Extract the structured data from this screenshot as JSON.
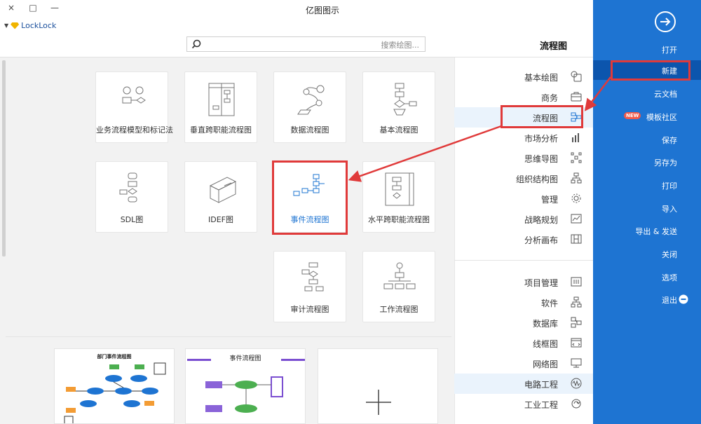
{
  "window": {
    "title": "亿图图示",
    "controls": [
      "×",
      "□",
      "—"
    ]
  },
  "user": {
    "name": "LockLock"
  },
  "search": {
    "placeholder": "搜索绘图..."
  },
  "section_title": "流程图",
  "templates": [
    {
      "label": "基本流程图"
    },
    {
      "label": "数据流程图"
    },
    {
      "label": "垂直跨职能流程图"
    },
    {
      "label": "业务流程模型和标记法"
    },
    {
      "label": "水平跨职能流程图"
    },
    {
      "label": "事件流程图"
    },
    {
      "label": "IDEF图"
    },
    {
      "label": "SDL图"
    },
    {
      "label": "工作流程图"
    },
    {
      "label": "审计流程图"
    }
  ],
  "examples": [
    {
      "title": "事件流程图"
    },
    {
      "title": "部门事件流程图"
    }
  ],
  "categories": [
    {
      "label": "基本绘图",
      "icon": "shapes-icon"
    },
    {
      "label": "商务",
      "icon": "briefcase-icon"
    },
    {
      "label": "流程图",
      "icon": "flowchart-icon"
    },
    {
      "label": "市场分析",
      "icon": "bar-chart-icon"
    },
    {
      "label": "思维导图",
      "icon": "mindmap-icon"
    },
    {
      "label": "组织结构图",
      "icon": "org-chart-icon"
    },
    {
      "label": "管理",
      "icon": "gear-icon"
    },
    {
      "label": "战略规划",
      "icon": "strategy-icon"
    },
    {
      "label": "分析画布",
      "icon": "canvas-icon"
    },
    {
      "label": "项目管理",
      "icon": "project-icon"
    },
    {
      "label": "软件",
      "icon": "software-icon"
    },
    {
      "label": "数据库",
      "icon": "database-icon"
    },
    {
      "label": "线框图",
      "icon": "wireframe-icon"
    },
    {
      "label": "网络图",
      "icon": "network-icon"
    },
    {
      "label": "电路工程",
      "icon": "circuit-icon"
    },
    {
      "label": "工业工程",
      "icon": "industry-icon"
    }
  ],
  "sidebar": {
    "items": [
      {
        "label": "打开"
      },
      {
        "label": "新建"
      },
      {
        "label": "云文档"
      },
      {
        "label": "模板社区",
        "badge": "NEW"
      },
      {
        "label": "保存"
      },
      {
        "label": "另存为"
      },
      {
        "label": "打印"
      },
      {
        "label": "导入"
      },
      {
        "label": "导出 & 发送"
      },
      {
        "label": "关闭"
      },
      {
        "label": "选项"
      },
      {
        "label": "退出"
      }
    ]
  },
  "colors": {
    "sidebar": "#1e74d2",
    "accent": "#1e74d2",
    "highlight": "#e03a3a"
  }
}
